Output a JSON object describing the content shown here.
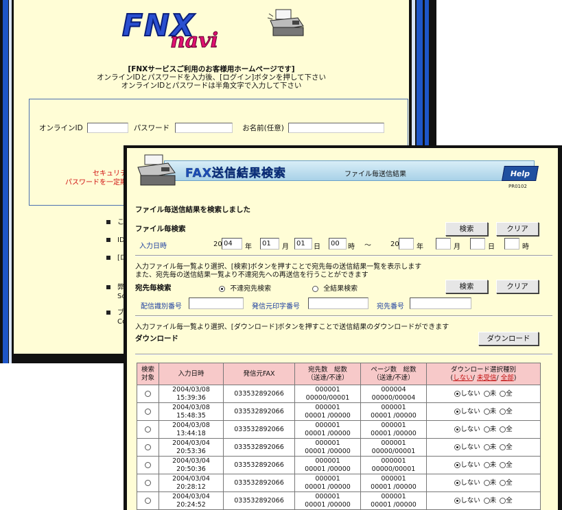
{
  "login_page": {
    "logo_main": "FNX",
    "logo_sub": "navi",
    "heading_line1": "[FNXサービスご利用のお客様用ホームページです]",
    "heading_line2": "オンラインIDとパスワードを入力後、[ログイン]ボタンを押して下さい",
    "heading_line3": "オンラインIDとパスワードは半角文字で入力して下さい",
    "online_id_label": "オンラインID",
    "password_label": "パスワード",
    "name_label": "お名前(任意)",
    "security_line1": "セキュリティ(",
    "security_line2": "パスワードを一定期間",
    "bullets": [
      "このホ",
      "ID・パ",
      "[ログ",
      "弊社&",
      "ブラウ"
    ],
    "bullet_extra": [
      "Socke",
      "Comm"
    ]
  },
  "fax_page": {
    "title": "FAX送信結果検索",
    "subtitle": "ファイル毎送信結果",
    "help_label": "Help",
    "screen_code": "PR0102",
    "result_message": "ファイル毎送信結果を検索しました",
    "file_search": {
      "heading": "ファイル毎検索",
      "date_label": "入力日時",
      "from_prefix": "20",
      "from_year": "04",
      "year_unit": "年",
      "from_month": "01",
      "month_unit": "月",
      "from_day": "01",
      "day_unit": "日",
      "from_hour": "00",
      "hour_unit": "時",
      "tilde": "～",
      "to_prefix": "20",
      "search_button": "検索",
      "clear_button": "クリア"
    },
    "desc1_line1": "入力ファイル毎一覧より選択、[検索]ボタンを押すことで宛先毎の送信結果一覧を表示します",
    "desc1_line2": "また、宛先毎の送信結果一覧より不達宛先への再送信を行うことができます",
    "dest_search": {
      "heading": "宛先毎検索",
      "radio_undelivered": "不達宛先検索",
      "radio_all": "全結果検索",
      "search_button": "検索",
      "clear_button": "クリア",
      "delivery_id_label": "配信識別番号",
      "sender_print_label": "発信元印字番号",
      "dest_number_label": "宛先番号"
    },
    "desc2": "入力ファイル毎一覧より選択、[ダウンロード]ボタンを押すことで送信結果のダウンロードができます",
    "download_heading": "ダウンロード",
    "download_button": "ダウンロード",
    "table": {
      "headers": {
        "target_l1": "検索",
        "target_l2": "対象",
        "datetime": "入力日時",
        "sender_fax": "発信元FAX",
        "dest_l1": "宛先数　総数",
        "dest_l2": "（送達/不達）",
        "pages_l1": "ページ数　総数",
        "pages_l2": "（送達/不達）",
        "dl_l1": "ダウンロード選択種別",
        "dl_none": "しない",
        "dl_unsent": "未受信",
        "dl_all": "全部"
      },
      "option_none": "しない",
      "option_unsent": "未",
      "option_all": "全",
      "rows": [
        {
          "date": "2004/03/08",
          "time": "15:39:36",
          "fax": "033532892066",
          "dest_total": "000001",
          "dest_ok": "00000/00001",
          "page_total": "000004",
          "page_ok": "00000/00004"
        },
        {
          "date": "2004/03/08",
          "time": "15:48:35",
          "fax": "033532892066",
          "dest_total": "000001",
          "dest_ok": "00001 /00000",
          "page_total": "000001",
          "page_ok": "00001 /00000"
        },
        {
          "date": "2004/03/08",
          "time": "13:44:18",
          "fax": "033532892066",
          "dest_total": "000001",
          "dest_ok": "00001 /00000",
          "page_total": "000001",
          "page_ok": "00001 /00000"
        },
        {
          "date": "2004/03/04",
          "time": "20:53:36",
          "fax": "033532892066",
          "dest_total": "000001",
          "dest_ok": "00001 /00000",
          "page_total": "000001",
          "page_ok": "00000/00001"
        },
        {
          "date": "2004/03/04",
          "time": "20:50:36",
          "fax": "033532892066",
          "dest_total": "000001",
          "dest_ok": "00001 /00000",
          "page_total": "000001",
          "page_ok": "00000/00001"
        },
        {
          "date": "2004/03/04",
          "time": "20:28:12",
          "fax": "033532892066",
          "dest_total": "000001",
          "dest_ok": "00001 /00000",
          "page_total": "000001",
          "page_ok": "00001 /00000"
        },
        {
          "date": "2004/03/04",
          "time": "20:24:52",
          "fax": "033532892066",
          "dest_total": "000001",
          "dest_ok": "00001 /00000",
          "page_total": "000001",
          "page_ok": "00001 /00000"
        }
      ]
    }
  },
  "colors": {
    "accent_blue": "#1d4fb8",
    "stripe_blue": "#1e56c8",
    "panel_bg": "#fffdd6",
    "header_pink": "#f7c9c9",
    "warning_red": "#d01010"
  }
}
